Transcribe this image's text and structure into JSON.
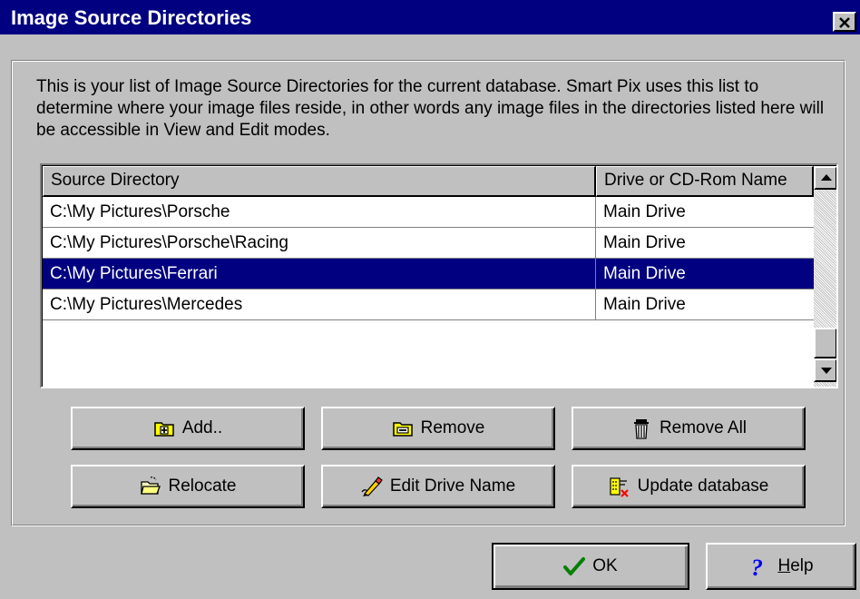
{
  "window": {
    "title": "Image Source Directories"
  },
  "description": "This is your list of Image Source Directories for the current database.  Smart Pix uses this list to determine where your image files reside, in other words any image files in the directories listed here will be accessible in View and Edit modes.",
  "list": {
    "columns": [
      "Source Directory",
      "Drive or CD-Rom Name"
    ],
    "rows": [
      {
        "dir": "C:\\My Pictures\\Porsche",
        "drive": "Main Drive"
      },
      {
        "dir": "C:\\My Pictures\\Porsche\\Racing",
        "drive": "Main Drive"
      },
      {
        "dir": "C:\\My Pictures\\Ferrari",
        "drive": "Main Drive"
      },
      {
        "dir": "C:\\My Pictures\\Mercedes",
        "drive": "Main Drive"
      }
    ],
    "selected_index": 2
  },
  "buttons": {
    "add": "Add..",
    "remove": "Remove",
    "remove_all": "Remove All",
    "relocate": "Relocate",
    "edit_drive_name": "Edit Drive Name",
    "update_database": "Update database",
    "ok": "OK",
    "help_rest": "elp",
    "help_mnemonic": "H"
  },
  "icons": {
    "close": "close-icon",
    "add": "folder-plus-icon",
    "remove": "folder-minus-icon",
    "remove_all": "trash-icon",
    "relocate": "folder-open-icon",
    "edit_drive_name": "pencil-icon",
    "update_database": "database-update-icon",
    "ok": "checkmark-icon",
    "help": "question-mark-icon"
  },
  "colors": {
    "titlebar": "#000080",
    "selection": "#000080",
    "face": "#c0c0c0",
    "ok_check": "#008000",
    "help_mark": "#0000ff"
  }
}
